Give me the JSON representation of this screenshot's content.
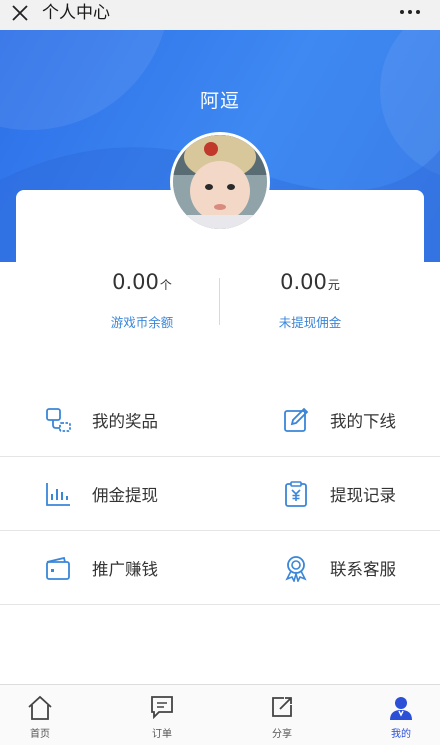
{
  "topbar": {
    "title": "个人中心"
  },
  "profile": {
    "username": "阿逗"
  },
  "stats": [
    {
      "value": "0.00",
      "unit": "个",
      "label": "游戏币余额"
    },
    {
      "value": "0.00",
      "unit": "元",
      "label": "未提现佣金"
    }
  ],
  "menu": [
    {
      "label": "我的奖品",
      "icon": "prize-icon"
    },
    {
      "label": "我的下线",
      "icon": "edit-icon"
    },
    {
      "label": "佣金提现",
      "icon": "bar-chart-icon"
    },
    {
      "label": "提现记录",
      "icon": "yen-clipboard-icon"
    },
    {
      "label": "推广赚钱",
      "icon": "wallet-icon"
    },
    {
      "label": "联系客服",
      "icon": "badge-icon"
    }
  ],
  "tabs": [
    {
      "label": "首页",
      "icon": "home-icon"
    },
    {
      "label": "订单",
      "icon": "message-icon"
    },
    {
      "label": "分享",
      "icon": "share-icon"
    },
    {
      "label": "我的",
      "icon": "user-icon",
      "active": true
    }
  ],
  "colors": {
    "accent": "#3a86d8",
    "hero": "#3e89f2",
    "tab_active": "#2b4fd6"
  }
}
